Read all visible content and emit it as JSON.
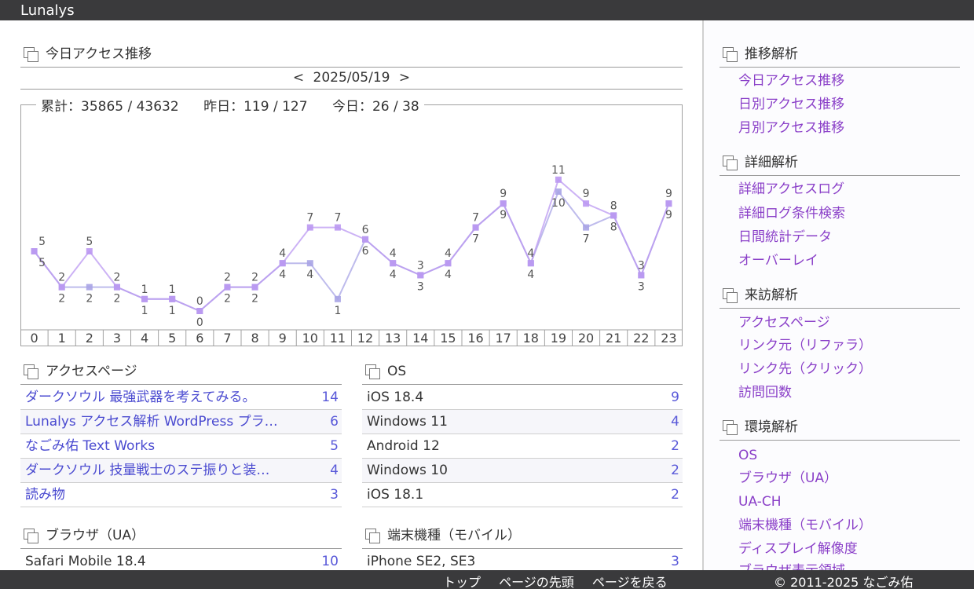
{
  "app": {
    "title": "Lunalys"
  },
  "today": {
    "title": "今日アクセス推移",
    "date_nav": {
      "prev": "<",
      "date": "2025/05/19",
      "next": ">"
    },
    "summary": {
      "total": "累計：35865 / 43632",
      "yesterday": "昨日：119 / 127",
      "today": "今日：26 / 38"
    }
  },
  "chart_data": {
    "type": "line",
    "x": [
      "0",
      "1",
      "2",
      "3",
      "4",
      "5",
      "6",
      "7",
      "8",
      "9",
      "10",
      "11",
      "12",
      "13",
      "14",
      "15",
      "16",
      "17",
      "18",
      "19",
      "20",
      "21",
      "22",
      "23"
    ],
    "ylim": [
      0,
      11
    ],
    "grid": false,
    "series": [
      {
        "color": "#bb98f2",
        "values": [
          5,
          2,
          5,
          2,
          1,
          1,
          0,
          2,
          2,
          4,
          7,
          7,
          6,
          4,
          3,
          4,
          7,
          9,
          4,
          11,
          9,
          8,
          3,
          9
        ]
      },
      {
        "color": "#a8a4e6",
        "values": [
          5,
          2,
          2,
          2,
          1,
          1,
          0,
          2,
          2,
          4,
          4,
          1,
          6,
          4,
          3,
          4,
          7,
          9,
          4,
          10,
          7,
          8,
          3,
          9
        ]
      }
    ]
  },
  "panels": {
    "pages": {
      "title": "アクセスページ",
      "rows": [
        {
          "name": "ダークソウル 最強武器を考えてみる。",
          "count": "14"
        },
        {
          "name": "Lunalys アクセス解析 WordPress プラ…",
          "count": "6"
        },
        {
          "name": "なごみ佑 Text Works",
          "count": "5"
        },
        {
          "name": "ダークソウル 技量戦士のステ振りと装…",
          "count": "4"
        },
        {
          "name": "読み物",
          "count": "3"
        }
      ]
    },
    "os": {
      "title": "OS",
      "rows": [
        {
          "name": "iOS 18.4",
          "count": "9"
        },
        {
          "name": "Windows 11",
          "count": "4"
        },
        {
          "name": "Android 12",
          "count": "2"
        },
        {
          "name": "Windows 10",
          "count": "2"
        },
        {
          "name": "iOS 18.1",
          "count": "2"
        }
      ]
    },
    "browser": {
      "title": "ブラウザ（UA）",
      "rows": [
        {
          "name": "Safari Mobile 18.4",
          "count": "10"
        }
      ]
    },
    "device": {
      "title": "端末機種（モバイル）",
      "rows": [
        {
          "name": "iPhone SE2, SE3",
          "count": "3"
        }
      ]
    }
  },
  "sidebar": {
    "groups": [
      {
        "title": "推移解析",
        "items": [
          "今日アクセス推移",
          "日別アクセス推移",
          "月別アクセス推移"
        ]
      },
      {
        "title": "詳細解析",
        "items": [
          "詳細アクセスログ",
          "詳細ログ条件検索",
          "日間統計データ",
          "オーバーレイ"
        ]
      },
      {
        "title": "来訪解析",
        "items": [
          "アクセスページ",
          "リンク元（リファラ）",
          "リンク先（クリック）",
          "訪問回数"
        ]
      },
      {
        "title": "環境解析",
        "items": [
          "OS",
          "ブラウザ（UA）",
          "UA-CH",
          "端末機種（モバイル）",
          "ディスプレイ解像度",
          "ブラウザ表示領域"
        ]
      }
    ]
  },
  "footer": {
    "links": [
      "トップ",
      "ページの先頭",
      "ページを戻る"
    ],
    "copyright": "© 2011-2025 なごみ佑"
  }
}
